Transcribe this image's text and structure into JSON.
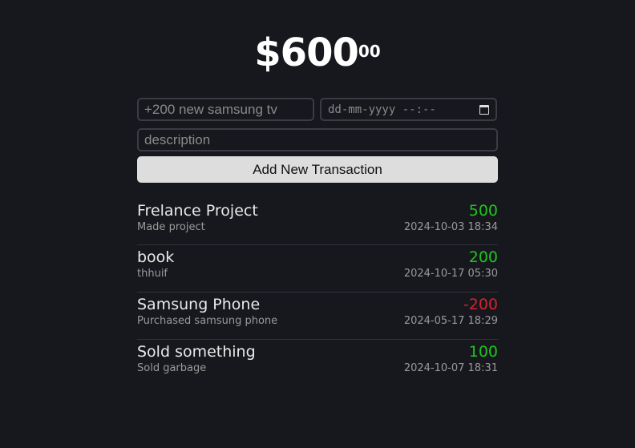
{
  "balance": {
    "main": "$600",
    "cents": "00"
  },
  "form": {
    "name_placeholder": "+200 new samsung tv",
    "date_placeholder": "dd-mm-yyyy --:--",
    "description_placeholder": "description",
    "add_label": "Add New Transaction"
  },
  "transactions": [
    {
      "name": "Frelance Project",
      "description": "Made project",
      "amount": "500",
      "type": "positive",
      "datetime": "2024-10-03 18:34"
    },
    {
      "name": "book",
      "description": "thhuif",
      "amount": "200",
      "type": "positive",
      "datetime": "2024-10-17 05:30"
    },
    {
      "name": "Samsung Phone",
      "description": "Purchased samsung phone",
      "amount": "-200",
      "type": "negative",
      "datetime": "2024-05-17 18:29"
    },
    {
      "name": "Sold something",
      "description": "Sold garbage",
      "amount": "100",
      "type": "positive",
      "datetime": "2024-10-07 18:31"
    }
  ],
  "colors": {
    "positive": "#1ec51e",
    "negative": "#d1242f",
    "background": "#17181e"
  },
  "icons": {
    "date": "calendar-icon"
  }
}
